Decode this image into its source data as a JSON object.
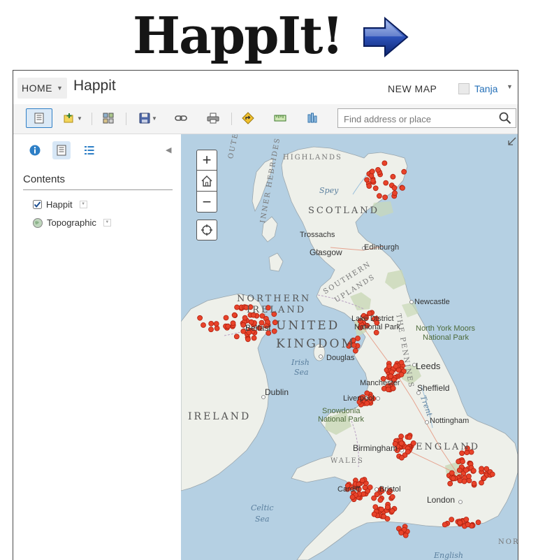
{
  "header": {
    "logo_text": "HappIt!",
    "next_icon": "arrow-right-icon"
  },
  "topbar": {
    "home_label": "HOME",
    "app_title": "Happit",
    "new_map_label": "NEW MAP",
    "user_name": "Tanja"
  },
  "toolbar": {
    "items": [
      {
        "name": "details-button",
        "icon": "document-icon"
      },
      {
        "name": "add-button",
        "icon": "add-layer-icon"
      },
      {
        "name": "basemap-button",
        "icon": "basemap-grid-icon"
      },
      {
        "name": "save-button",
        "icon": "save-icon"
      },
      {
        "name": "share-button",
        "icon": "link-icon"
      },
      {
        "name": "print-button",
        "icon": "print-icon"
      },
      {
        "name": "directions-button",
        "icon": "directions-icon"
      },
      {
        "name": "measure-button",
        "icon": "measure-icon"
      },
      {
        "name": "bookmarks-button",
        "icon": "bookmark-icon"
      }
    ],
    "search_placeholder": "Find address or place"
  },
  "left_panel": {
    "contents_heading": "Contents",
    "layers": [
      {
        "label": "Happit",
        "checked": true
      },
      {
        "label": "Topographic",
        "checked": false
      }
    ]
  },
  "map": {
    "zoom_in": "+",
    "zoom_out": "−",
    "accent_marker_color": "#e8432a",
    "labels": {
      "highlands": "HIGHLANDS",
      "outer_hebrides": "OUTER HEBRIDES",
      "inner_hebrides": "INNER HEBRIDES",
      "spey": "Spey",
      "scotland": "SCOTLAND",
      "trossachs": "Trossachs",
      "glasgow": "Glasgow",
      "edinburgh": "Edinburgh",
      "southern_uplands_1": "SOUTHERN",
      "southern_uplands_2": "UPLANDS",
      "northern_ireland_1": "NORTHERN",
      "northern_ireland_2": "IRELAND",
      "newcastle": "Newcastle",
      "lake_district_1": "Lake District",
      "lake_district_2": "National Park",
      "north_york_moors_1": "North York Moors",
      "north_york_moors_2": "National Park",
      "belfast": "Belfast",
      "united": "UNITED",
      "kingdom": "KINGDOM",
      "pennines": "THE PENNINES",
      "douglas": "Douglas",
      "irish_sea_1": "Irish",
      "irish_sea_2": "Sea",
      "leeds": "Leeds",
      "manchester": "Manchester",
      "sheffield": "Sheffield",
      "dublin": "Dublin",
      "liverpool": "Liverpool",
      "trent": "Trent",
      "snowdonia_1": "Snowdonia",
      "snowdonia_2": "National Park",
      "nottingham": "Nottingham",
      "ireland": "IRELAND",
      "birmingham": "Birmingham",
      "england": "ENGLAND",
      "wales": "WALES",
      "cardiff": "Cardiff",
      "bristol": "Bristol",
      "london": "London",
      "celtic_sea_1": "Celtic",
      "celtic_sea_2": "Sea",
      "english_channel": "English",
      "nor": "NOR"
    }
  }
}
